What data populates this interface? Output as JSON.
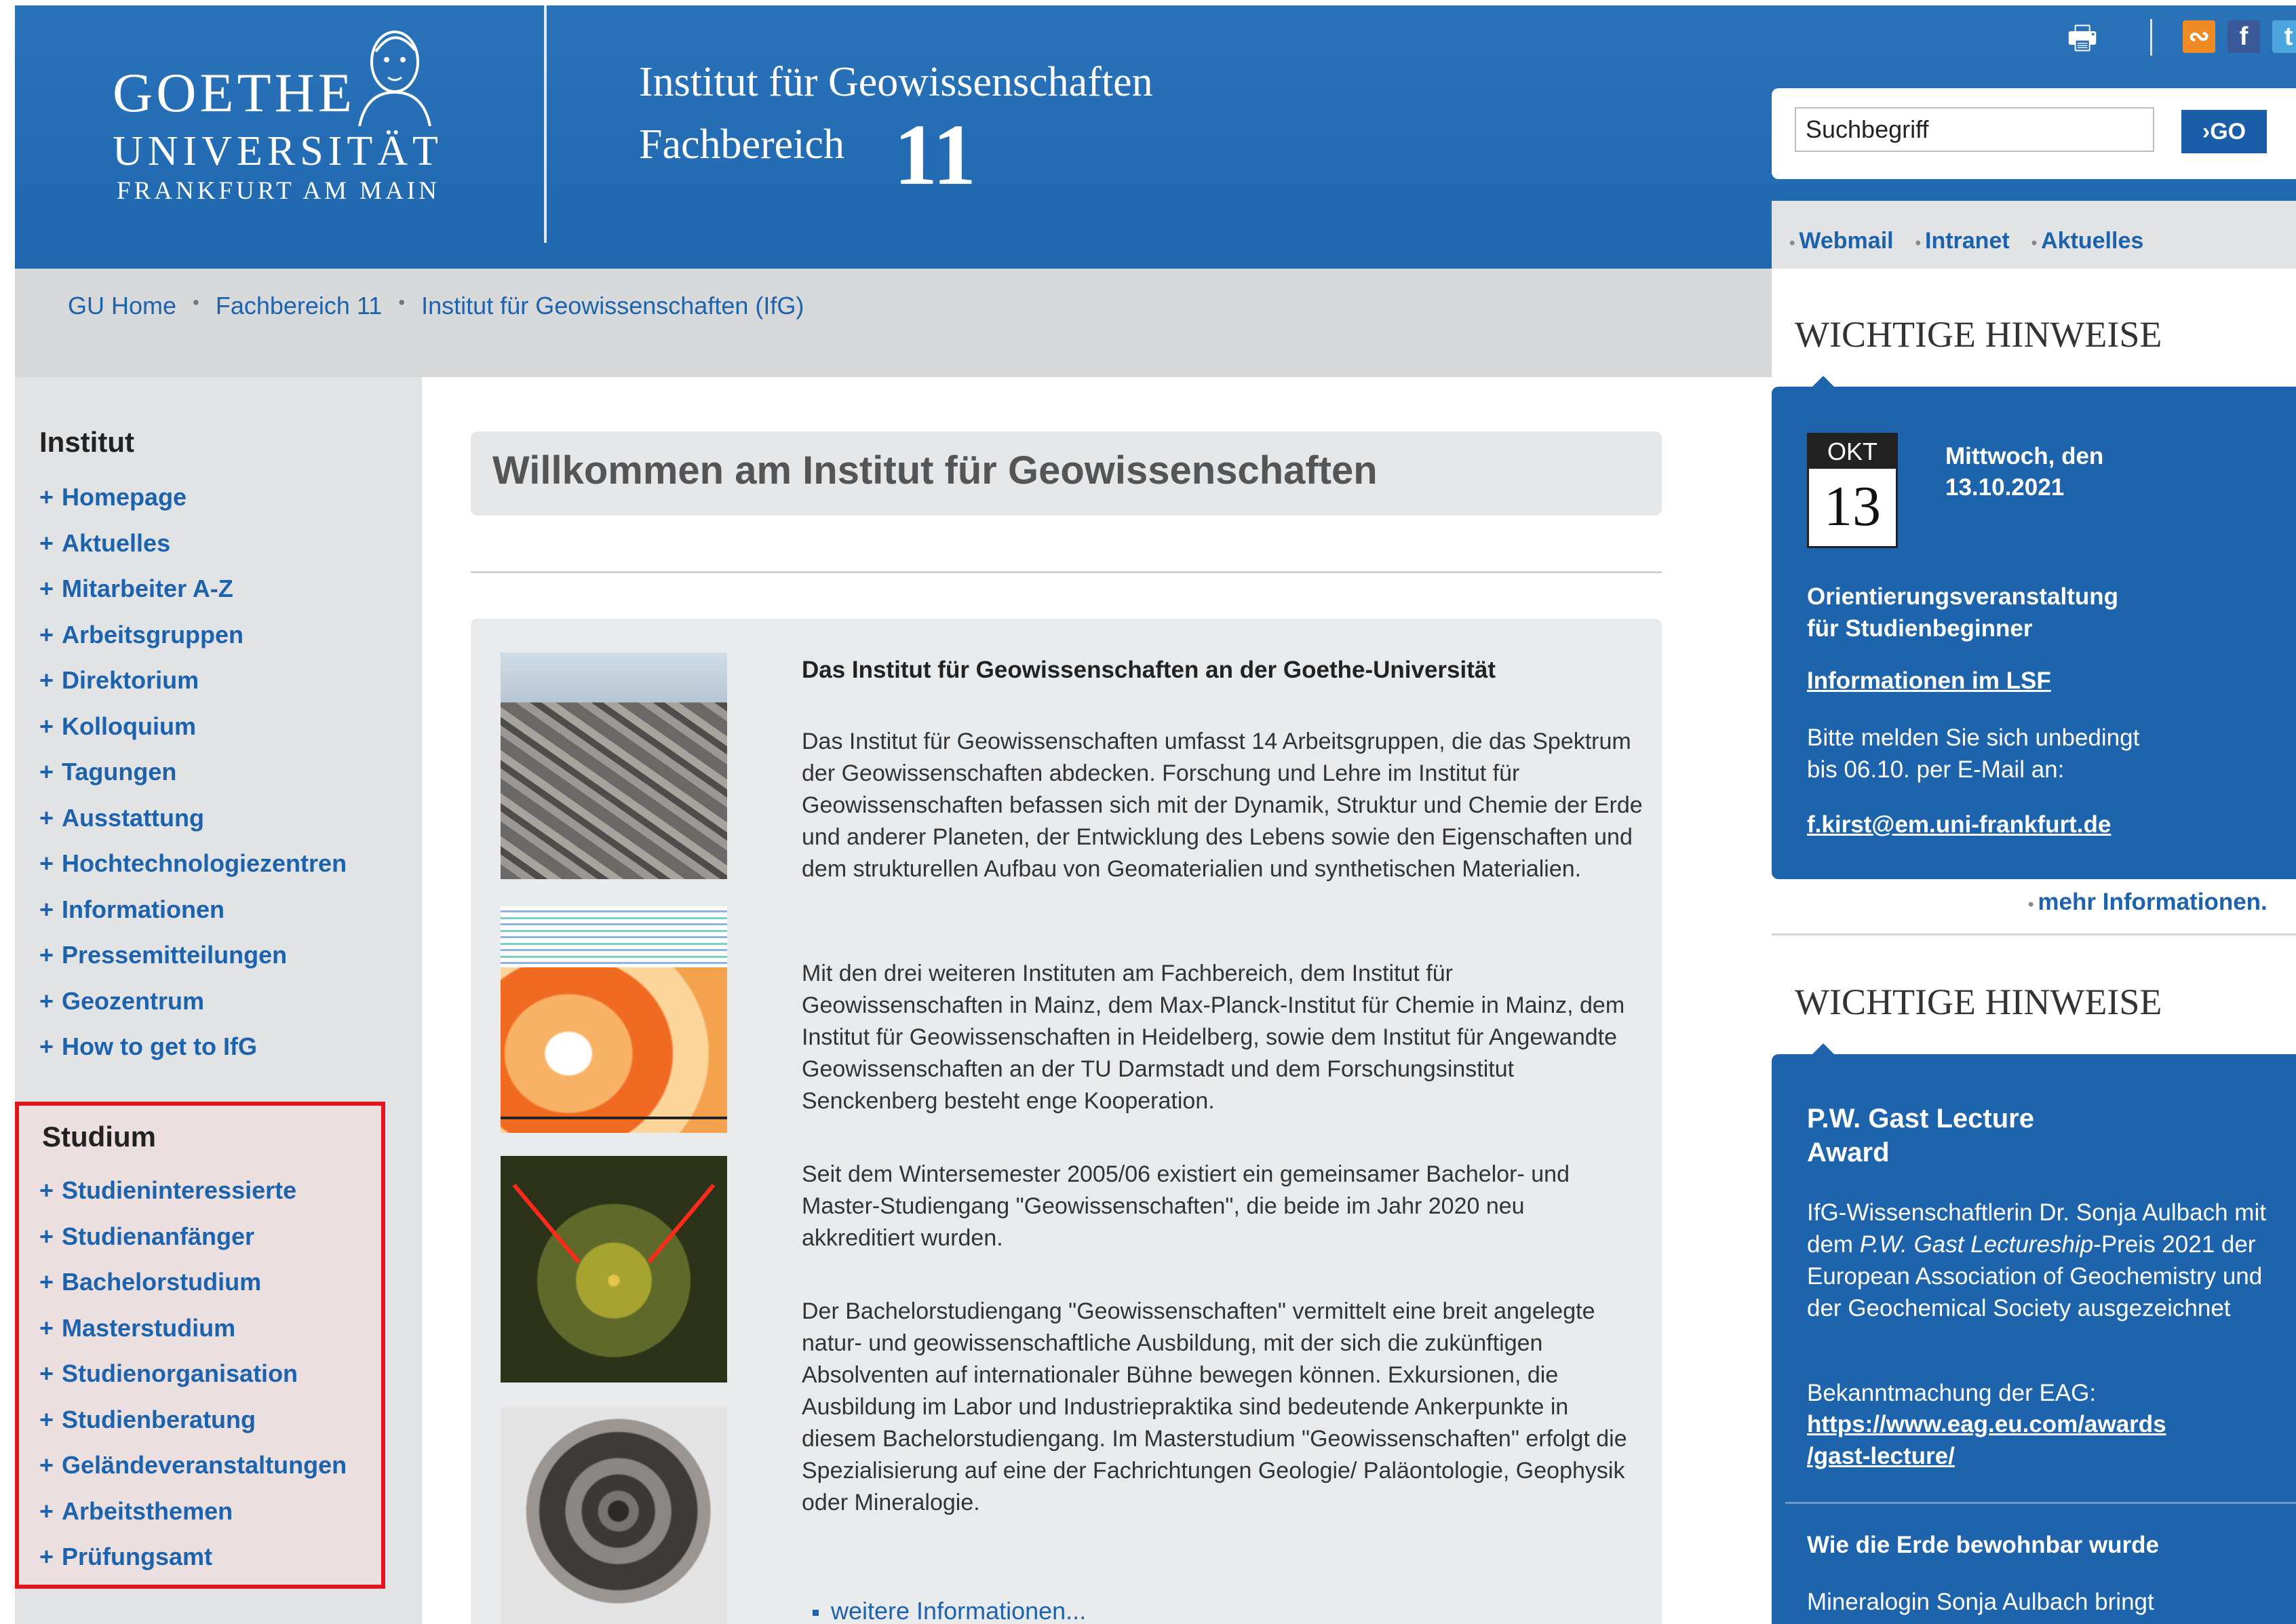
{
  "colors": {
    "header_blue": "#1f68b0",
    "link_blue": "#1c62ad",
    "highlight_red": "#e3161e",
    "gray_band": "#d8d9da"
  },
  "header": {
    "logo": {
      "line1": "GOETHE",
      "line2": "UNIVERSITÄT",
      "line3": "FRANKFURT AM MAIN"
    },
    "institute_title": "Institut für Geowissenschaften",
    "fachbereich_label": "Fachbereich",
    "fachbereich_number": "11",
    "icons": [
      "print-icon",
      "rss-icon",
      "facebook-icon",
      "twitter-icon"
    ],
    "search": {
      "value": "Suchbegriff",
      "button": "GO"
    }
  },
  "toplinks": [
    "Webmail",
    "Intranet",
    "Aktuelles"
  ],
  "breadcrumb": [
    "GU Home",
    "Fachbereich 11",
    "Institut für Geowissenschaften (IfG)"
  ],
  "leftnav": {
    "institut_heading": "Institut",
    "institut_items": [
      "Homepage",
      "Aktuelles",
      "Mitarbeiter A-Z",
      "Arbeitsgruppen",
      "Direktorium",
      "Kolloquium",
      "Tagungen",
      "Ausstattung",
      "Hochtechnologiezentren",
      "Informationen",
      "Pressemitteilungen",
      "Geozentrum",
      "How to get to IfG"
    ],
    "studium_heading": "Studium",
    "studium_items": [
      "Studieninteressierte",
      "Studienanfänger",
      "Bachelorstudium",
      "Masterstudium",
      "Studienorganisation",
      "Studienberatung",
      "Geländeveranstaltungen",
      "Arbeitsthemen",
      "Prüfungsamt"
    ]
  },
  "main": {
    "welcome_title": "Willkommen am Institut für Geowissenschaften",
    "article_heading": "Das Institut für Geowissenschaften an der Goethe-Universität",
    "paragraphs": [
      "Das Institut für Geowissenschaften umfasst 14 Arbeitsgruppen, die das Spektrum der Geowissenschaften abdecken. Forschung und Lehre im Institut für Geowissenschaften befassen sich mit der Dynamik, Struktur und Chemie der Erde und anderer Planeten, der Entwicklung des Lebens sowie den Eigenschaften und dem strukturellen Aufbau von Geomaterialien und synthetischen Materialien.",
      "Mit den drei weiteren Instituten am Fachbereich, dem Institut für Geowissenschaften in Mainz, dem Max-Planck-Institut für Chemie in Mainz, dem Institut für Geowissenschaften in Heidelberg, sowie dem Institut für Angewandte Geowissenschaften an der TU Darmstadt und dem Forschungsinstitut Senckenberg besteht enge Kooperation.",
      "Seit dem Wintersemester 2005/06 existiert ein gemeinsamer Bachelor- und Master-Studiengang \"Geowissenschaften\", die beide im Jahr 2020 neu akkreditiert wurden.",
      "Der Bachelorstudiengang \"Geowissenschaften\" vermittelt eine breit angelegte natur- und geowissenschaftliche Ausbildung, mit der sich die zukünftigen Absolventen auf internationaler Bühne bewegen können. Exkursionen, die Ausbildung im Labor und Industriepraktika sind bedeutende Ankerpunkte in diesem Bachelorstudiengang. Im Masterstudium \"Geowissenschaften\" erfolgt die Spezialisierung auf eine der Fachrichtungen Geologie/ Paläontologie, Geophysik oder Mineralogie."
    ],
    "more_link": "weitere Informationen..."
  },
  "sidebar": {
    "heading1": "WICHTIGE HINWEISE",
    "cal_month": "OKT",
    "cal_day": "13",
    "weekday_line1": "Mittwoch, den",
    "weekday_line2": "13.10.2021",
    "event_title_line1": "Orientierungsveranstaltung",
    "event_title_line2": "für Studienbeginner",
    "lsf_link": "Informationen im LSF",
    "notice_line1": "Bitte melden Sie sich unbedingt",
    "notice_line2": "bis 06.10. per E-Mail an:",
    "email": "f.kirst@em.uni-frankfurt.de",
    "more_info": "mehr Informationen.",
    "heading2": "WICHTIGE HINWEISE",
    "award_title_line1": "P.W. Gast Lecture",
    "award_title_line2": "Award",
    "award_text_a": "IfG-Wissenschaftlerin Dr. Sonja",
    "award_text_b": "Aulbach mit dem",
    "award_text_c": "P.W. Gast",
    "award_text_d": "Lectureship",
    "award_text_e": "-Preis 2021 der European",
    "award_text_f": "Association of Geochemistry und der",
    "award_text_g": "Geochemical Society ausgezeichnet",
    "eag_label": "Bekanntmachung der EAG:",
    "eag_link_line1": "https://www.eag.eu.com/awards",
    "eag_link_line2": "/gast-lecture/",
    "story_title": "Wie die Erde bewohnbar wurde",
    "story_text": "Mineralogin Sonja Aulbach bringt"
  }
}
